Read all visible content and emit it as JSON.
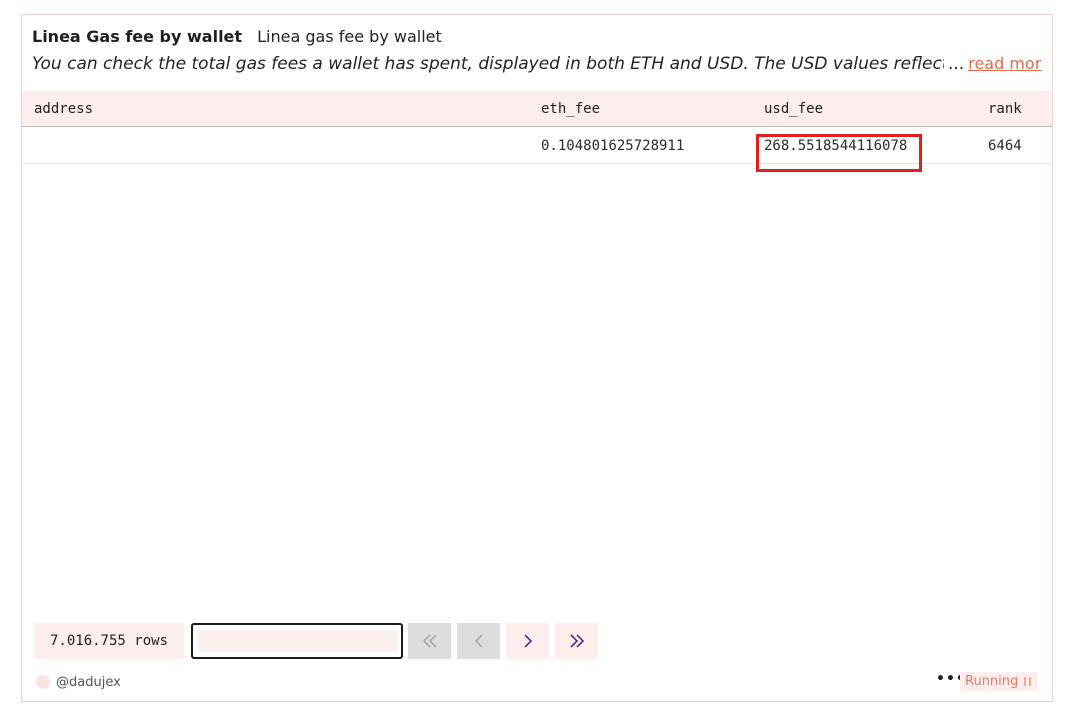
{
  "header": {
    "title": "Linea Gas fee by wallet",
    "subtitle": "Linea gas fee by wallet",
    "description": "You can check the total gas fees a wallet has spent, displayed in both ETH and USD. The USD values reflect the ETH p",
    "ellipsis": "...",
    "read_more": "read more"
  },
  "table": {
    "columns": [
      "address",
      "eth_fee",
      "usd_fee",
      "rank"
    ],
    "rows": [
      {
        "address": "",
        "eth_fee": "0.104801625728911",
        "usd_fee": "268.5518544116078",
        "rank": "6464"
      }
    ]
  },
  "pagination": {
    "rows_count": "7.016.755 rows",
    "page_input_value": "",
    "first_icon": "double-chevron-left-icon",
    "prev_icon": "chevron-left-icon",
    "next_icon": "chevron-right-icon",
    "last_icon": "double-chevron-right-icon"
  },
  "footer": {
    "author": "@dadujex",
    "more": "•••",
    "status": "Running"
  },
  "colors": {
    "accent": "#e06a4a",
    "header_bg": "#fdeeed",
    "highlight_border": "#e02020",
    "nav_icon": "#3b1f8f"
  }
}
